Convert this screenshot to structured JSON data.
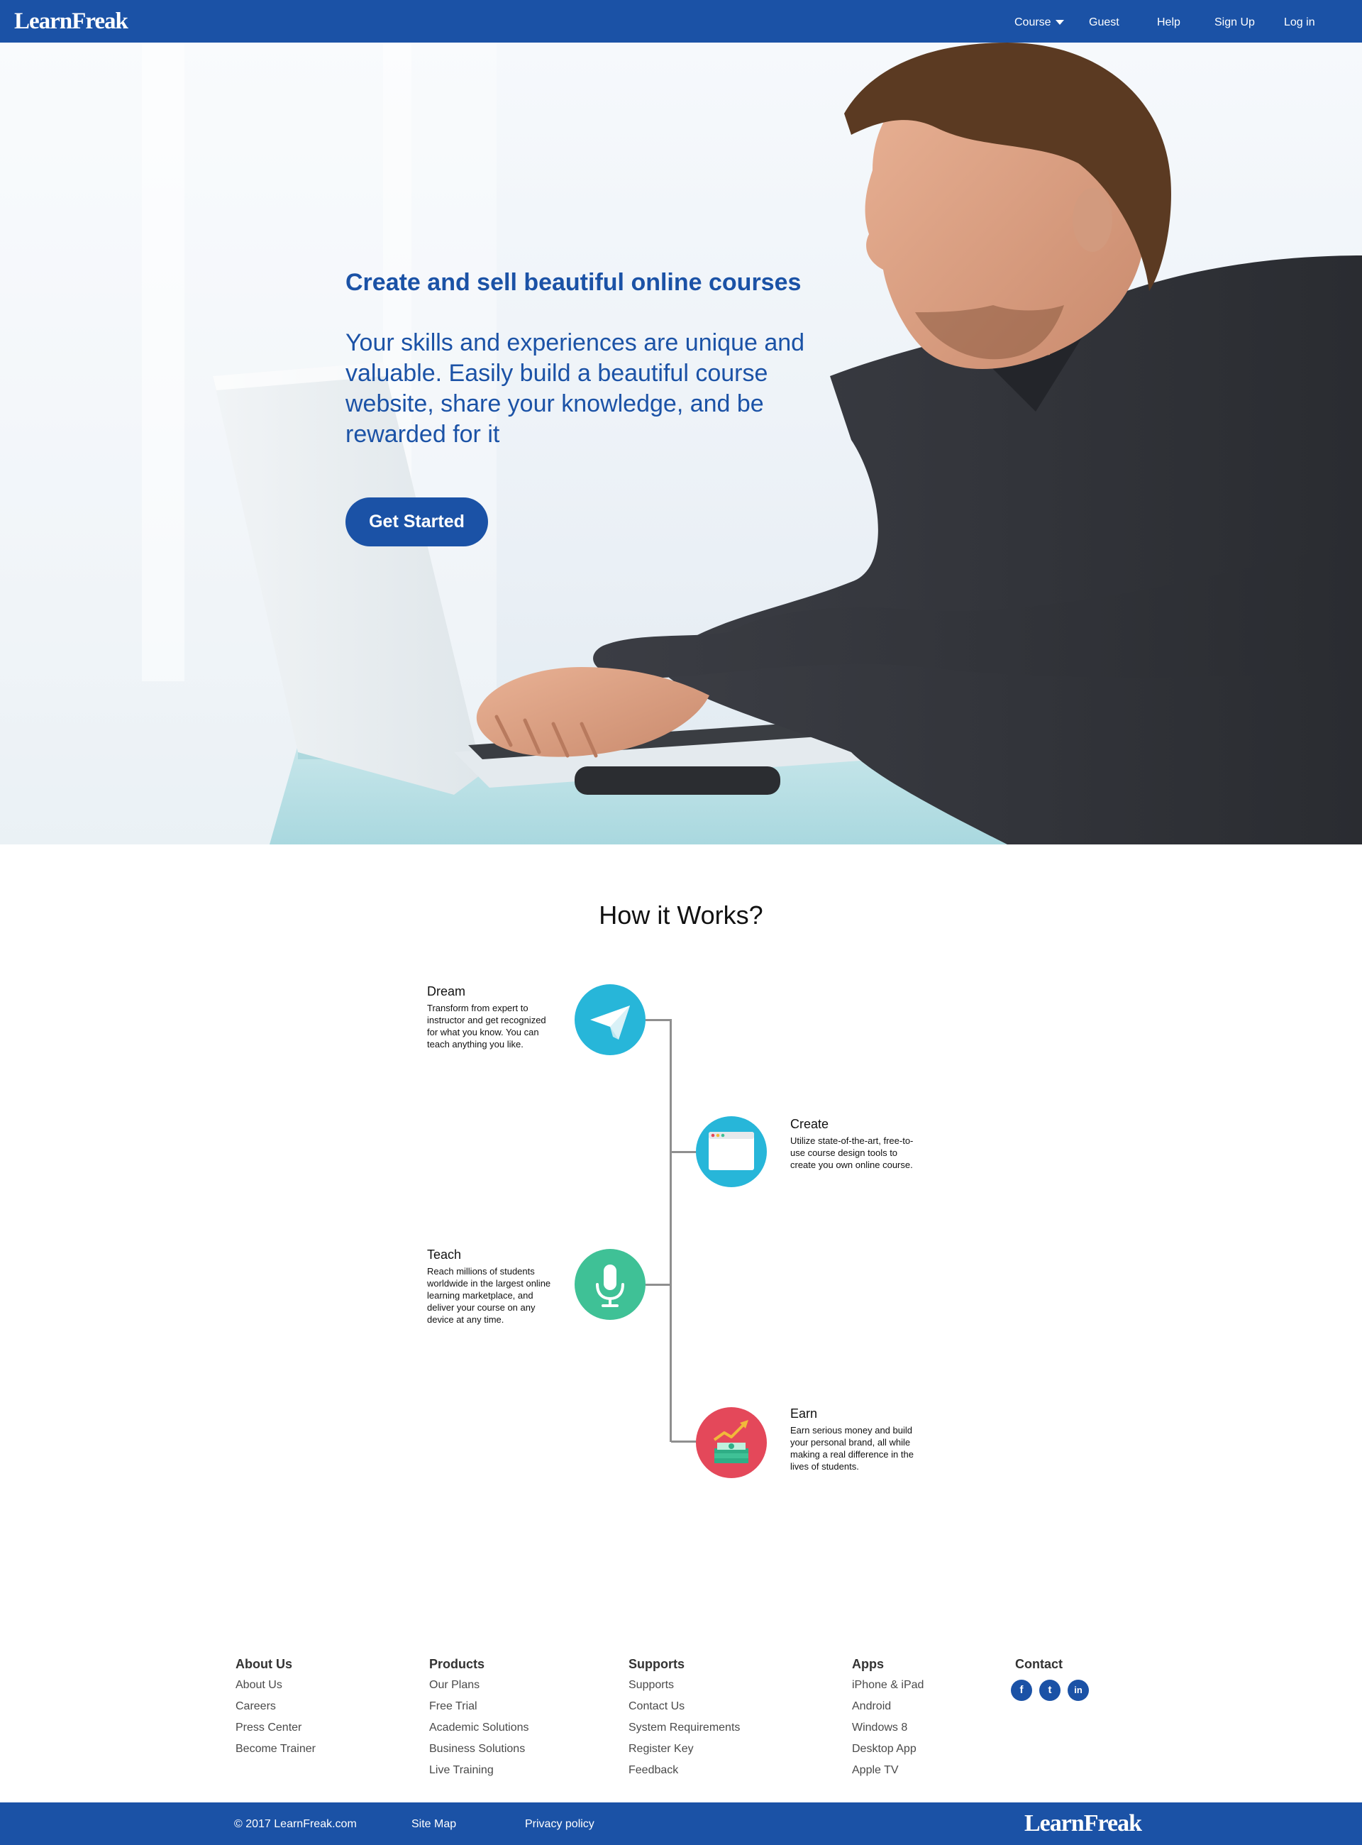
{
  "header": {
    "brand": "LearnFreak",
    "nav": [
      {
        "label": "Course",
        "has_dropdown": true
      },
      {
        "label": "Guest"
      },
      {
        "label": "Help"
      },
      {
        "label": "Sign Up"
      },
      {
        "label": "Log in"
      }
    ]
  },
  "hero": {
    "title": "Create and sell beautiful online courses",
    "text": "Your skills and experiences are unique and valuable. Easily build a beautiful course website, share your knowledge, and be rewarded for it",
    "cta": "Get Started"
  },
  "how": {
    "title": "How it Works?",
    "steps": [
      {
        "title": "Dream",
        "description": "Transform from expert to instructor and get recognized for what you know. You can teach anything you like.",
        "icon": "paper-plane-icon",
        "color": "#27b6d9"
      },
      {
        "title": "Create",
        "description": "Utilize state-of-the-art, free-to-use course design tools to create you own online course.",
        "icon": "browser-window-icon",
        "color": "#27b6d9"
      },
      {
        "title": "Teach",
        "description": "Reach millions of students worldwide in the largest online learning marketplace, and deliver your course on any device at any time.",
        "icon": "microphone-icon",
        "color": "#3fc196"
      },
      {
        "title": "Earn",
        "description": "Earn serious money and build your personal brand, all while making a real difference in the lives of students.",
        "icon": "money-growth-icon",
        "color": "#e4485a"
      }
    ]
  },
  "footer": {
    "columns": [
      {
        "title": "About Us",
        "links": [
          "About Us",
          "Careers",
          "Press Center",
          "Become Trainer"
        ]
      },
      {
        "title": "Products",
        "links": [
          "Our Plans",
          "Free Trial",
          "Academic Solutions",
          "Business Solutions",
          "Live Training"
        ]
      },
      {
        "title": "Supports",
        "links": [
          "Supports",
          "Contact Us",
          "System Requirements",
          "Register Key",
          "Feedback"
        ]
      },
      {
        "title": "Apps",
        "links": [
          "iPhone & iPad",
          "Android",
          "Windows 8",
          "Desktop App",
          "Apple TV"
        ]
      },
      {
        "title": "Contact",
        "links": []
      }
    ],
    "social": [
      {
        "icon": "facebook-icon",
        "glyph": "f"
      },
      {
        "icon": "twitter-icon",
        "glyph": "t"
      },
      {
        "icon": "linkedin-icon",
        "glyph": "in"
      }
    ],
    "copyright": "© 2017 LearnFreak.com",
    "site_map": "Site Map",
    "privacy": "Privacy policy",
    "brand": "LearnFreak"
  },
  "colors": {
    "brand_blue": "#1b52a6",
    "teal": "#27b6d9",
    "green": "#3fc196",
    "red": "#e4485a"
  }
}
